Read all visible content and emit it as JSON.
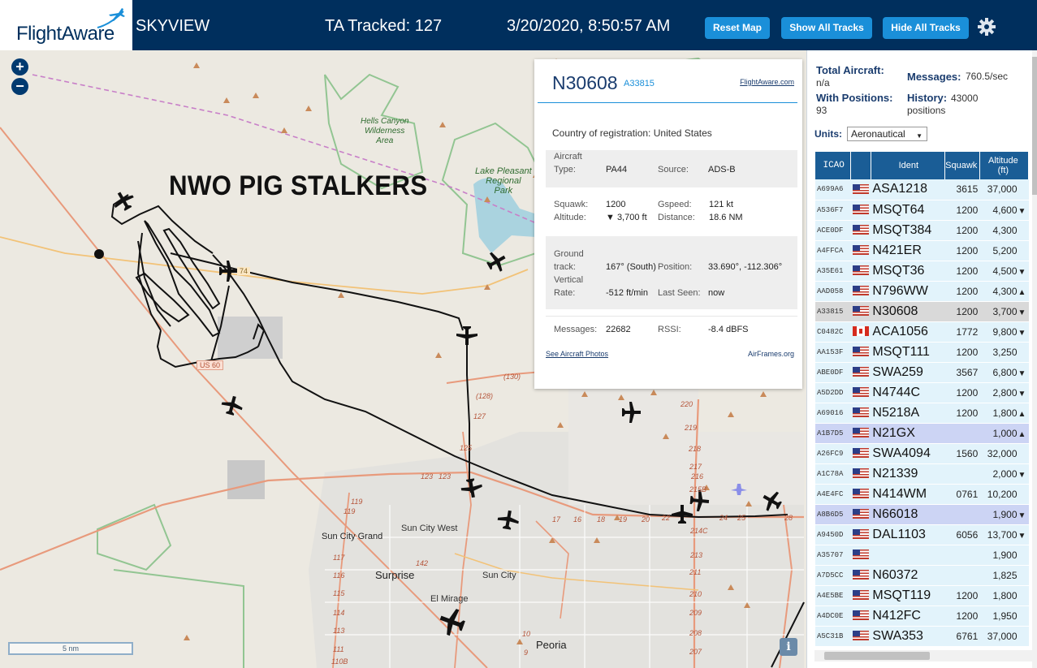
{
  "header": {
    "logo_text": "FlightAware",
    "app_name": "SKYVIEW",
    "tracked": "TA Tracked: 127",
    "datetime": "3/20/2020, 8:50:57 AM",
    "buttons": {
      "reset": "Reset Map",
      "show_all": "Show All Tracks",
      "hide_all": "Hide All Tracks"
    },
    "colors": {
      "bar": "#002f5d",
      "button": "#1a8fd9"
    }
  },
  "map": {
    "overlay_title": "NWO PIG STALKERS",
    "zoom_in": "+",
    "zoom_out": "−",
    "scale": "5 nm",
    "info": "i",
    "parks": {
      "hells_canyon": "Hells Canyon\nWilderness\nArea",
      "lake_pleasant": "Lake Pleasant\nRegional\nPark"
    },
    "places": {
      "sun_city_grand": "Sun City Grand",
      "sun_city_west": "Sun City West",
      "surprise": "Surprise",
      "sun_city": "Sun City",
      "el_mirage": "El Mirage",
      "peoria": "Peoria"
    },
    "road_labels": {
      "us60": "US 60",
      "r74": "74",
      "r130": "(130)",
      "r128": "(128)",
      "r127": "127",
      "r125": "125",
      "r123": "123",
      "r123b": "123",
      "r142": "142",
      "r119": "119",
      "r119b": "119",
      "r220": "220",
      "r219": "219",
      "r218": "218",
      "r217": "217",
      "r216": "216",
      "r215b": "215B",
      "r214c": "214C",
      "r213": "213",
      "r212": "212",
      "r211": "211",
      "r210": "210",
      "r209": "209",
      "r208": "208",
      "r207": "207",
      "r17": "17",
      "r16": "16",
      "r18": "18",
      "r19": "19",
      "r20": "20",
      "r22": "22",
      "r24": "24",
      "r25": "25",
      "r28": "28",
      "r117": "117",
      "r116": "116",
      "r115": "115",
      "r114": "114",
      "r113": "113",
      "r112": "112",
      "r111": "111",
      "r110b": "110B",
      "r10": "10",
      "r9": "9"
    }
  },
  "popup": {
    "ident": "N30608",
    "hex": "A33815",
    "link_fa": "FlightAware.com",
    "country_label": "Country of registration:",
    "country_value": "United States",
    "aircraft_type_label": "Aircraft\nType:",
    "aircraft_type_value": "PA44",
    "source_label": "Source:",
    "source_value": "ADS-B",
    "squawk_label": "Squawk:",
    "squawk_value": "1200",
    "gspeed_label": "Gspeed:",
    "gspeed_value": "121 kt",
    "altitude_label": "Altitude:",
    "altitude_value": "▼ 3,700 ft",
    "distance_label": "Distance:",
    "distance_value": "18.6 NM",
    "track_label": "Ground\ntrack:",
    "track_value": "167° (South)",
    "position_label": "Position:",
    "position_value": "33.690°, -112.306°",
    "vrate_label": "Vertical\nRate:",
    "vrate_value": "-512 ft/min",
    "lastseen_label": "Last Seen:",
    "lastseen_value": "now",
    "messages_label": "Messages:",
    "messages_value": "22682",
    "rssi_label": "RSSI:",
    "rssi_value": "-8.4 dBFS",
    "photos_link": "See Aircraft Photos",
    "airframes_link": "AirFrames.org"
  },
  "sidebar": {
    "total_label": "Total Aircraft:",
    "total_value": "n/a",
    "messages_label": "Messages:",
    "messages_value": "760.5/sec",
    "positions_label": "With Positions:",
    "positions_value": "93",
    "history_label": "History:",
    "history_value": "43000\npositions",
    "units_label": "Units:",
    "units_value": "Aeronautical",
    "columns": {
      "icao": "ICAO",
      "ident": "Ident",
      "squawk": "Squawk",
      "altitude": "Altitude\n(ft)"
    },
    "rows": [
      {
        "icao": "A699A6",
        "flag": "us",
        "ident": "ASA1218",
        "squawk": "3615",
        "alt": "37,000",
        "trend": ""
      },
      {
        "icao": "A536F7",
        "flag": "us",
        "ident": "MSQT64",
        "squawk": "1200",
        "alt": "4,600",
        "trend": "▼"
      },
      {
        "icao": "ACE0DF",
        "flag": "us",
        "ident": "MSQT384",
        "squawk": "1200",
        "alt": "4,300",
        "trend": ""
      },
      {
        "icao": "A4FFCA",
        "flag": "us",
        "ident": "N421ER",
        "squawk": "1200",
        "alt": "5,200",
        "trend": ""
      },
      {
        "icao": "A35E61",
        "flag": "us",
        "ident": "MSQT36",
        "squawk": "1200",
        "alt": "4,500",
        "trend": "▼"
      },
      {
        "icao": "AAD058",
        "flag": "us",
        "ident": "N796WW",
        "squawk": "1200",
        "alt": "4,300",
        "trend": "▲"
      },
      {
        "icao": "A33815",
        "flag": "us",
        "ident": "N30608",
        "squawk": "1200",
        "alt": "3,700",
        "trend": "▼"
      },
      {
        "icao": "C0482C",
        "flag": "ca",
        "ident": "ACA1056",
        "squawk": "1772",
        "alt": "9,800",
        "trend": "▼"
      },
      {
        "icao": "AA153F",
        "flag": "us",
        "ident": "MSQT111",
        "squawk": "1200",
        "alt": "3,250",
        "trend": ""
      },
      {
        "icao": "ABE0DF",
        "flag": "us",
        "ident": "SWA259",
        "squawk": "3567",
        "alt": "6,800",
        "trend": "▼"
      },
      {
        "icao": "A5D2DD",
        "flag": "us",
        "ident": "N4744C",
        "squawk": "1200",
        "alt": "2,800",
        "trend": "▼"
      },
      {
        "icao": "A69016",
        "flag": "us",
        "ident": "N5218A",
        "squawk": "1200",
        "alt": "1,800",
        "trend": "▲"
      },
      {
        "icao": "A1B7D5",
        "flag": "us",
        "ident": "N21GX",
        "squawk": "",
        "alt": "1,000",
        "trend": "▲"
      },
      {
        "icao": "A26FC9",
        "flag": "us",
        "ident": "SWA4094",
        "squawk": "1560",
        "alt": "32,000",
        "trend": ""
      },
      {
        "icao": "A1C78A",
        "flag": "us",
        "ident": "N21339",
        "squawk": "",
        "alt": "2,000",
        "trend": "▼"
      },
      {
        "icao": "A4E4FC",
        "flag": "us",
        "ident": "N414WM",
        "squawk": "0761",
        "alt": "10,200",
        "trend": ""
      },
      {
        "icao": "A8B6D5",
        "flag": "us",
        "ident": "N66018",
        "squawk": "",
        "alt": "1,900",
        "trend": "▼"
      },
      {
        "icao": "A9450D",
        "flag": "us",
        "ident": "DAL1103",
        "squawk": "6056",
        "alt": "13,700",
        "trend": "▼"
      },
      {
        "icao": "A35707",
        "flag": "us",
        "ident": "",
        "squawk": "",
        "alt": "1,900",
        "trend": ""
      },
      {
        "icao": "A7D5CC",
        "flag": "us",
        "ident": "N60372",
        "squawk": "",
        "alt": "1,825",
        "trend": ""
      },
      {
        "icao": "A4E5BE",
        "flag": "us",
        "ident": "MSQT119",
        "squawk": "1200",
        "alt": "1,800",
        "trend": ""
      },
      {
        "icao": "A4DC0E",
        "flag": "us",
        "ident": "N412FC",
        "squawk": "1200",
        "alt": "1,950",
        "trend": ""
      },
      {
        "icao": "A5C31B",
        "flag": "us",
        "ident": "SWA353",
        "squawk": "6761",
        "alt": "37,000",
        "trend": ""
      }
    ]
  }
}
